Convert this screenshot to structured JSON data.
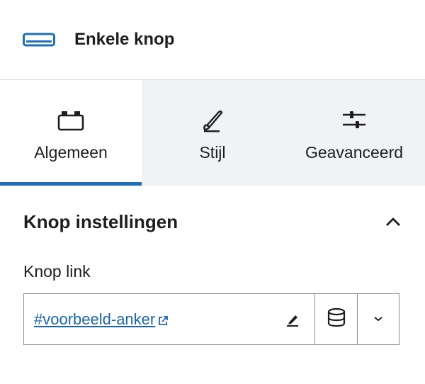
{
  "header": {
    "title": "Enkele knop",
    "icon": "button-block-icon"
  },
  "tabs": [
    {
      "label": "Algemeen",
      "icon": "layout-icon",
      "active": true
    },
    {
      "label": "Stijl",
      "icon": "brush-icon",
      "active": false
    },
    {
      "label": "Geavanceerd",
      "icon": "sliders-icon",
      "active": false
    }
  ],
  "panel": {
    "title": "Knop instellingen",
    "expanded": true,
    "link_label": "Knop link",
    "link_value": "#voorbeeld-anker"
  },
  "colors": {
    "accent": "#1e6fb8",
    "link": "#1a65b0",
    "tab_inactive_bg": "#f0f2f5"
  }
}
